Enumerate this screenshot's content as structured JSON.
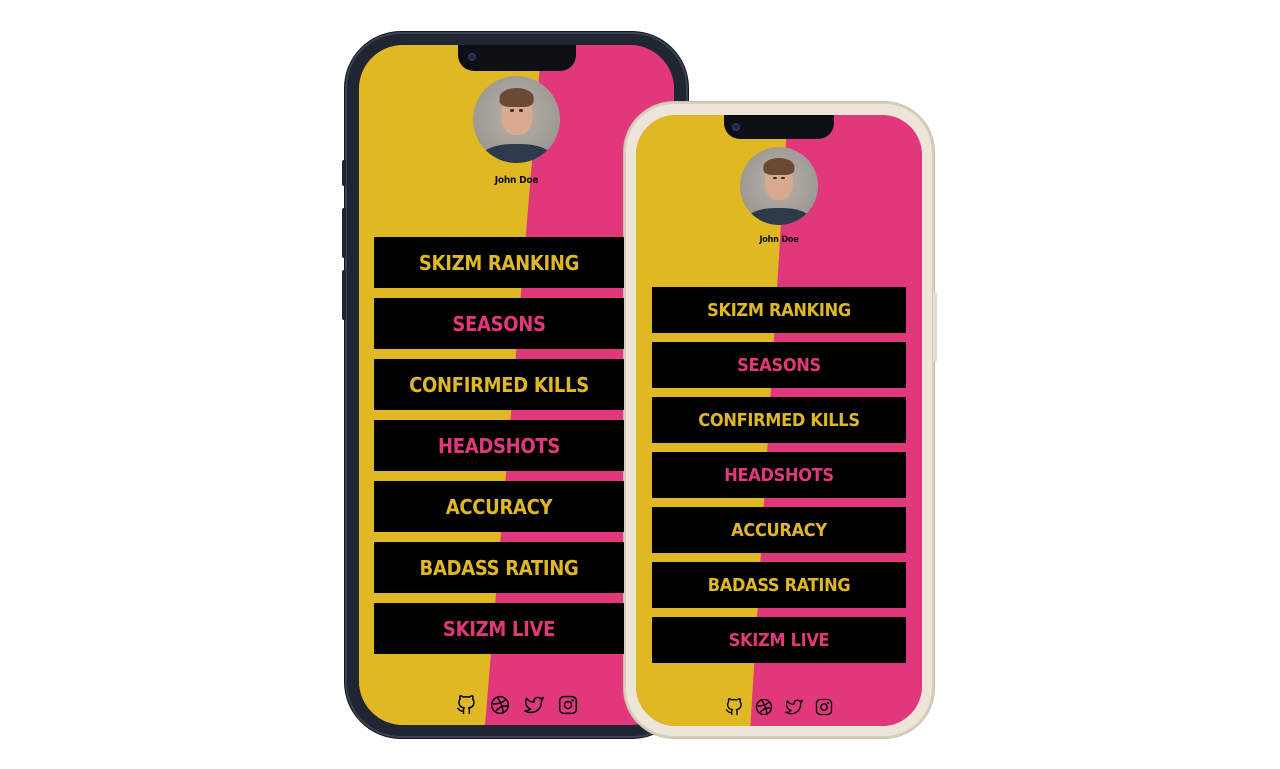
{
  "colors": {
    "yellow": "#e0b823",
    "pink": "#e0387b",
    "button_bg": "#000000",
    "back_frame": "#1f2531",
    "front_frame": "#ece5d8"
  },
  "profile": {
    "name": "John Doe"
  },
  "links": [
    {
      "label": "SKIZM RANKING",
      "color": "yellow"
    },
    {
      "label": "SEASONS",
      "color": "pink"
    },
    {
      "label": "CONFIRMED KILLS",
      "color": "yellow"
    },
    {
      "label": "HEADSHOTS",
      "color": "pink"
    },
    {
      "label": "ACCURACY",
      "color": "yellow"
    },
    {
      "label": "BADASS RATING",
      "color": "yellow"
    },
    {
      "label": "SKIZM LIVE",
      "color": "pink"
    }
  ],
  "socials": [
    {
      "icon": "github-icon"
    },
    {
      "icon": "dribbble-icon"
    },
    {
      "icon": "twitter-icon"
    },
    {
      "icon": "instagram-icon"
    }
  ]
}
